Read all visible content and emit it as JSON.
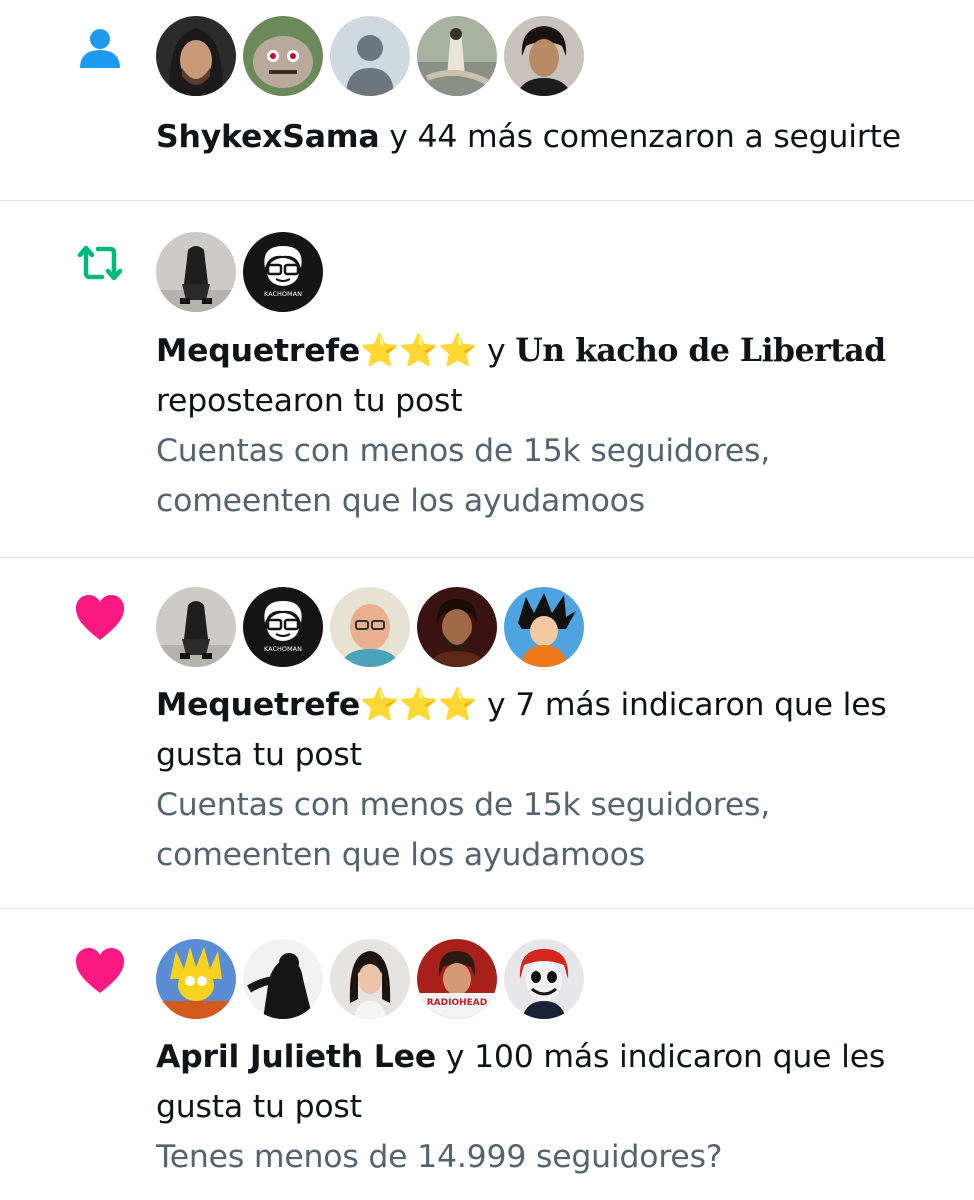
{
  "notifications": [
    {
      "type": "follow",
      "icon": "person-icon",
      "icon_color": "#1d9bf0",
      "actor": "ShykexSama",
      "action": "y 44 más comenzaron a seguirte",
      "avatars": [
        "hooded-man",
        "monster",
        "default-avatar",
        "painting",
        "man-portrait"
      ]
    },
    {
      "type": "repost",
      "icon": "repost-icon",
      "icon_color": "#00ba7c",
      "actor": "Mequetrefe",
      "actor_emoji": "⭐⭐⭐",
      "connector": "y",
      "actor2": "Un kacho de Libertad",
      "action": "repostearon tu post",
      "snippet": "Cuentas con menos de 15k seguidores, comeenten que los ayudamoos",
      "avatars": [
        "hoodie-sitting",
        "kachoman-logo"
      ],
      "kachoman_label": "KACHOMAN"
    },
    {
      "type": "like",
      "icon": "heart-icon",
      "icon_color": "#f91880",
      "actor": "Mequetrefe",
      "actor_emoji": "⭐⭐⭐",
      "action": "y 7 más indicaron que les gusta tu post",
      "snippet": "Cuentas con menos de 15k seguidores, comeenten que los ayudamoos",
      "avatars": [
        "hoodie-sitting",
        "kachoman-logo",
        "bald-man-glasses",
        "bearded-man",
        "goku"
      ],
      "kachoman_label": "KACHOMAN"
    },
    {
      "type": "like",
      "icon": "heart-icon",
      "icon_color": "#f91880",
      "actor": "April Julieth Lee",
      "action": "y 100 más indicaron que les gusta tu post",
      "snippet": "Tenes menos de 14.999 seguidores?",
      "avatars": [
        "simpsons-lisa",
        "dark-figure",
        "woman-portrait",
        "radiohead-player",
        "clown-face"
      ],
      "radiohead_label": "RADIOHEAD"
    }
  ]
}
